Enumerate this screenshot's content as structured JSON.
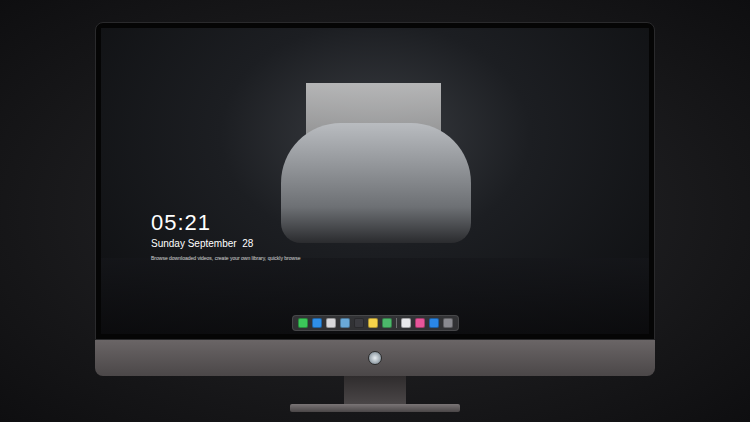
{
  "lock_screen": {
    "time": "05:21",
    "date": "Sunday September  28",
    "notice": "Browse downloaded videos, create your own library, quickly browse"
  },
  "dock": {
    "apps": [
      {
        "color": "#3cc85a"
      },
      {
        "color": "#2f8fe8"
      },
      {
        "color": "#d9d9dc"
      },
      {
        "color": "#6aa9d8"
      },
      {
        "color": "#3b3b40"
      },
      {
        "color": "#f5d24a"
      },
      {
        "color": "#4cb86a"
      },
      {
        "color": "#e9e9ec"
      },
      {
        "color": "#e8559a"
      },
      {
        "color": "#2a86e6"
      },
      {
        "color": "#8a8a90"
      }
    ]
  }
}
